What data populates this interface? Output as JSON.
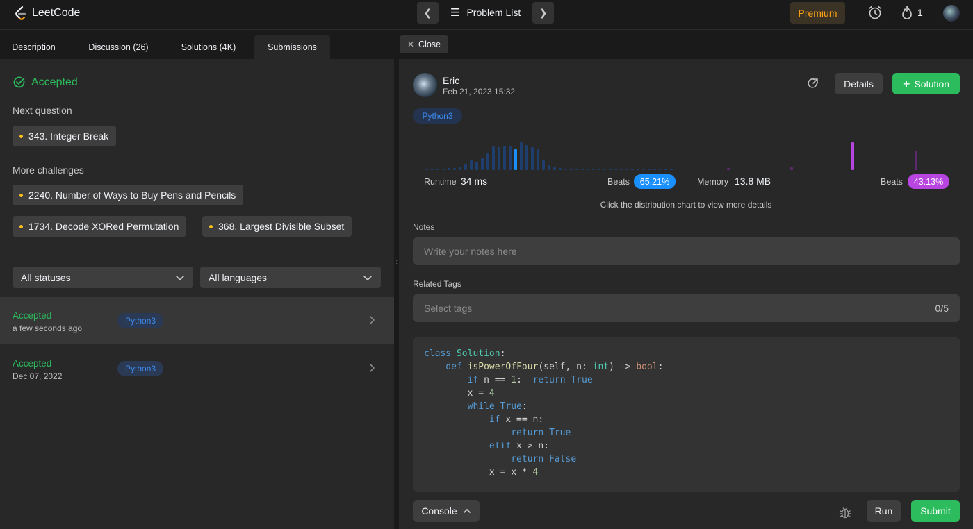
{
  "app": {
    "brand": "LeetCode"
  },
  "topbar": {
    "problem_list": "Problem List",
    "premium": "Premium",
    "streak_count": "1"
  },
  "left_tabs": [
    "Description",
    "Discussion (26)",
    "Solutions (4K)",
    "Submissions"
  ],
  "result": {
    "status": "Accepted",
    "next_question_label": "Next question",
    "next_question": "343. Integer Break",
    "more_challenges_label": "More challenges",
    "challenges": [
      "2240. Number of Ways to Buy Pens and Pencils",
      "1734. Decode XORed Permutation",
      "368. Largest Divisible Subset"
    ]
  },
  "filters": {
    "status": "All statuses",
    "language": "All languages"
  },
  "submissions": [
    {
      "status": "Accepted",
      "time": "a few seconds ago",
      "lang": "Python3"
    },
    {
      "status": "Accepted",
      "time": "Dec 07, 2022",
      "lang": "Python3"
    }
  ],
  "detail": {
    "close": "Close",
    "user": "Eric",
    "date": "Feb 21, 2023 15:32",
    "details_btn": "Details",
    "solution_btn": "Solution",
    "language": "Python3",
    "runtime_label": "Runtime",
    "runtime": "34 ms",
    "runtime_beats_label": "Beats",
    "runtime_beats": "65.21%",
    "memory_label": "Memory",
    "memory": "13.8 MB",
    "memory_beats_label": "Beats",
    "memory_beats": "43.13%",
    "hint": "Click the distribution chart to view more details",
    "notes_label": "Notes",
    "notes_placeholder": "Write your notes here",
    "tags_label": "Related Tags",
    "tags_placeholder": "Select tags",
    "tags_count": "0/5"
  },
  "code": [
    "class Solution:",
    "    def isPowerOfFour(self, n: int) -> bool:",
    "        if n == 1:  return True",
    "        x = 4",
    "        while True:",
    "            if x == n:",
    "                return True",
    "            elif x > n:",
    "                return False",
    "            x = x * 4"
  ],
  "footer": {
    "console": "Console",
    "run": "Run",
    "submit": "Submit"
  },
  "colors": {
    "accent_green": "#2cbb5d",
    "brand_orange": "#ffa116",
    "runtime_blue": "#1a90ff",
    "memory_purple": "#b845e0",
    "bg_panel": "#282828"
  }
}
